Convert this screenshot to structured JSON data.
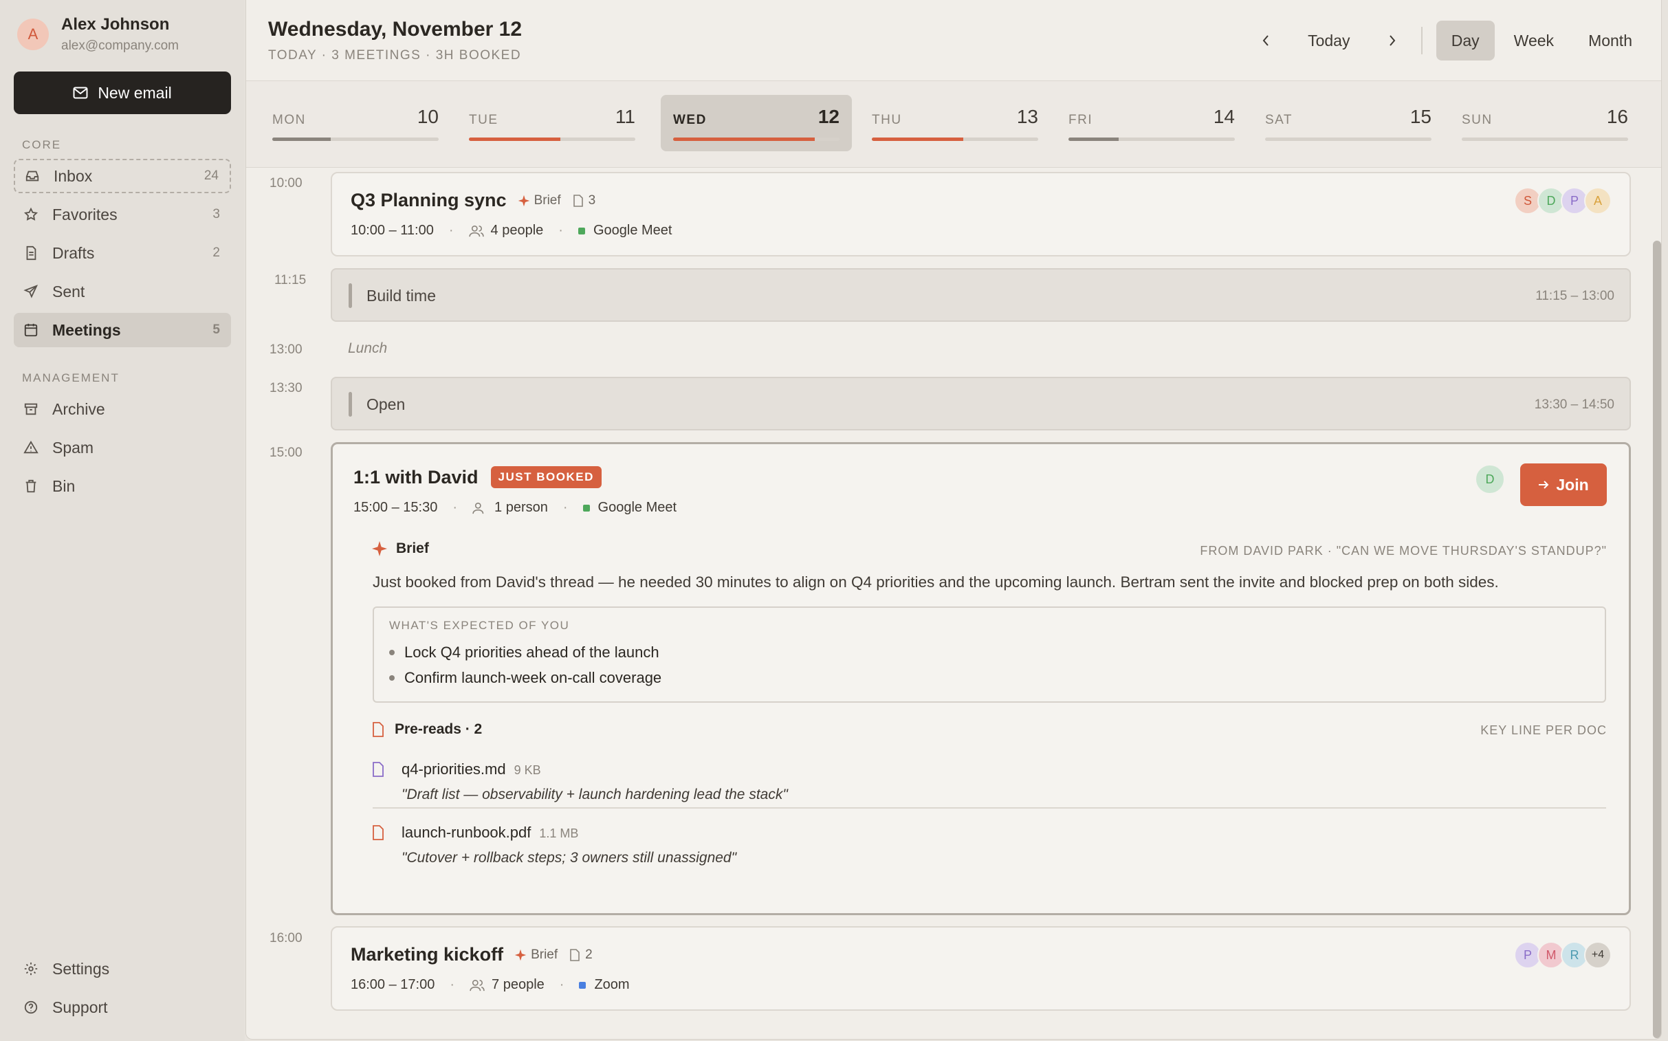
{
  "user": {
    "initial": "A",
    "name": "Alex Johnson",
    "email": "alex@company.com"
  },
  "new_email_label": "New email",
  "sections": {
    "core": "CORE",
    "management": "MANAGEMENT"
  },
  "nav": {
    "core": [
      {
        "label": "Inbox",
        "count": "24",
        "icon": "inbox-icon"
      },
      {
        "label": "Favorites",
        "count": "3",
        "icon": "star-icon"
      },
      {
        "label": "Drafts",
        "count": "2",
        "icon": "draft-icon"
      },
      {
        "label": "Sent",
        "count": "",
        "icon": "send-icon"
      },
      {
        "label": "Meetings",
        "count": "5",
        "icon": "calendar-icon"
      }
    ],
    "management": [
      {
        "label": "Archive",
        "icon": "archive-icon"
      },
      {
        "label": "Spam",
        "icon": "warning-icon"
      },
      {
        "label": "Bin",
        "icon": "trash-icon"
      }
    ],
    "bottom": [
      {
        "label": "Settings",
        "icon": "gear-icon"
      },
      {
        "label": "Support",
        "icon": "help-icon"
      }
    ]
  },
  "header": {
    "date": "Wednesday, November 12",
    "subtitle": "TODAY · 3 MEETINGS · 3H BOOKED",
    "today": "Today",
    "views": [
      "Day",
      "Week",
      "Month"
    ],
    "selected_view": "Day"
  },
  "week": [
    {
      "name": "MON",
      "num": "10",
      "load": 0.35
    },
    {
      "name": "TUE",
      "num": "11",
      "load": 0.55
    },
    {
      "name": "WED",
      "num": "12",
      "load": 0.85
    },
    {
      "name": "THU",
      "num": "13",
      "load": 0.55
    },
    {
      "name": "FRI",
      "num": "14",
      "load": 0.3
    },
    {
      "name": "SAT",
      "num": "15",
      "load": 0
    },
    {
      "name": "SUN",
      "num": "16",
      "load": 0
    }
  ],
  "selected_day": "WED",
  "colors": {
    "accent": "#d6603f",
    "meet": "#4ea85b",
    "zoom": "#4a7fe0",
    "neutral_bar": "#8a847c"
  },
  "times": [
    "10:00",
    "11:15",
    "13:00",
    "13:30",
    "15:00",
    "16:00"
  ],
  "events": {
    "q3": {
      "title": "Q3 Planning sync",
      "brief": "Brief",
      "docs": "3",
      "time": "10:00 – 11:00",
      "people": "4 people",
      "location": "Google Meet",
      "attendees": [
        "S",
        "D",
        "P",
        "A"
      ]
    },
    "build": {
      "label": "Build time",
      "range": "11:15 – 13:00"
    },
    "lunch": {
      "label": "Lunch"
    },
    "open": {
      "label": "Open",
      "range": "13:30 – 14:50"
    },
    "david": {
      "title": "1:1 with David",
      "tag": "JUST BOOKED",
      "time": "15:00 – 15:30",
      "people": "1 person",
      "location": "Google Meet",
      "attendee": "D",
      "join": "Join",
      "brief_label": "Brief",
      "from": "FROM DAVID PARK · \"CAN WE MOVE THURSDAY'S STANDUP?\"",
      "summary": "Just booked from David's thread — he needed 30 minutes to align on Q4 priorities and the upcoming launch. Bertram sent the invite and blocked prep on both sides.",
      "expected_label": "WHAT'S EXPECTED OF YOU",
      "expected": [
        "Lock Q4 priorities ahead of the launch",
        "Confirm launch-week on-call coverage"
      ],
      "prereads_label": "Pre-reads · 2",
      "keyline": "KEY LINE PER DOC",
      "files": [
        {
          "name": "q4-priorities.md",
          "size": "9 KB",
          "quote": "\"Draft list — observability + launch hardening lead the stack\"",
          "icon": "doc-icon"
        },
        {
          "name": "launch-runbook.pdf",
          "size": "1.1 MB",
          "quote": "\"Cutover + rollback steps; 3 owners still unassigned\"",
          "icon": "pdf-icon"
        }
      ]
    },
    "marketing": {
      "title": "Marketing kickoff",
      "brief": "Brief",
      "docs": "2",
      "time": "16:00 – 17:00",
      "people": "7 people",
      "location": "Zoom",
      "attendees": [
        "P",
        "M",
        "R"
      ],
      "more": "+4"
    }
  }
}
